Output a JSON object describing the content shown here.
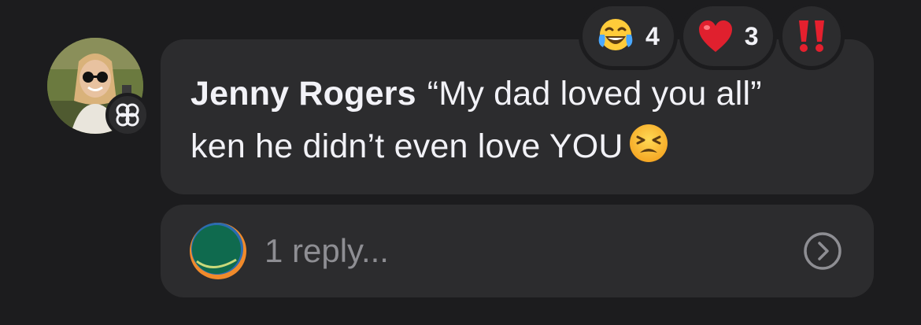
{
  "comment": {
    "author": "Jenny Rogers",
    "text_line1": "“My dad loved you all”",
    "text_line2": "ken he didn’t even love YOU",
    "trailing_emoji": "tired-face-emoji"
  },
  "avatar": {
    "badge_icon": "community-badge-icon"
  },
  "reactions": [
    {
      "emoji": "face-with-tears-of-joy-emoji",
      "count": "4"
    },
    {
      "emoji": "red-heart-emoji",
      "count": "3"
    },
    {
      "emoji": "double-exclamation-emoji",
      "count": ""
    }
  ],
  "replies": {
    "label": "1 reply...",
    "icon": "chevron-right-circle-icon"
  },
  "colors": {
    "background": "#1c1c1e",
    "bubble": "#2c2c2e",
    "text": "#f2f2f7",
    "secondary_text": "#8e8e93",
    "heart": "#e0202e",
    "exclamation": "#e5202e"
  }
}
